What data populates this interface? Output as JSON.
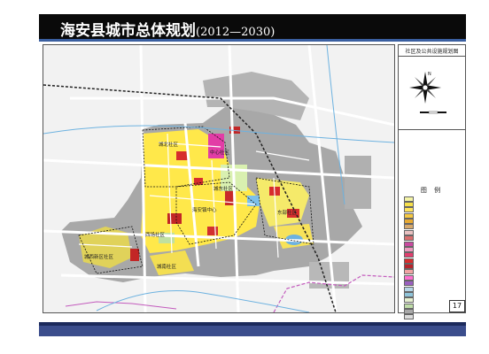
{
  "header": {
    "title": "海安县城市总体规划",
    "years": "(2012—2030)"
  },
  "side_panel": {
    "title": "社区及公共设施规划图",
    "compass_label": "N",
    "legend_title": "图 例",
    "legend_items": [
      {
        "label": "",
        "color": "#f4f4a6"
      },
      {
        "label": "",
        "color": "#f7e04a"
      },
      {
        "label": "",
        "color": "#ffe45c"
      },
      {
        "label": "",
        "color": "#f5c842"
      },
      {
        "label": "",
        "color": "#e8aa33"
      },
      {
        "label": "",
        "color": "#d7a96c"
      },
      {
        "label": "",
        "color": "#e9c0c0"
      },
      {
        "label": "",
        "color": "#d96d6d"
      },
      {
        "label": "",
        "color": "#c94aa0"
      },
      {
        "label": "",
        "color": "#ef9ac0"
      },
      {
        "label": "",
        "color": "#e13e6e"
      },
      {
        "label": "",
        "color": "#d62d2d"
      },
      {
        "label": "",
        "color": "#b8232b"
      },
      {
        "label": "",
        "color": "#f1a4a4"
      },
      {
        "label": "",
        "color": "#ff6fcf"
      },
      {
        "label": "",
        "color": "#9a5fbf"
      },
      {
        "label": "",
        "color": "#b6d7e8"
      },
      {
        "label": "",
        "color": "#8fc4d9"
      },
      {
        "label": "",
        "color": "#e6f0d0"
      },
      {
        "label": "",
        "color": "#bfdca8"
      },
      {
        "label": "",
        "color": "#a9a9a9"
      },
      {
        "label": "",
        "color": "#dcdcdc"
      }
    ]
  },
  "map_labels": {
    "label_north": "城北社区",
    "label_center_top": "中心社区",
    "label_east_center": "城东社区",
    "label_center_mid": "海安镇中心",
    "label_east": "东部社区",
    "label_southwest": "西场社区",
    "label_west": "城西新区社区",
    "label_south": "城南社区"
  },
  "page_number": "17",
  "colors": {
    "title_bar": "#0a0a0a",
    "accent_blue": "#3a5fa0",
    "bottom_bar": "#3b4d8c",
    "built_gray": "#a0a0a0",
    "residential_yellow": "#ffe84a",
    "commercial_red": "#d62d2d",
    "road_white": "#ffffff",
    "water_blue": "#6db2e0",
    "boundary_purple": "#c35bbd"
  }
}
